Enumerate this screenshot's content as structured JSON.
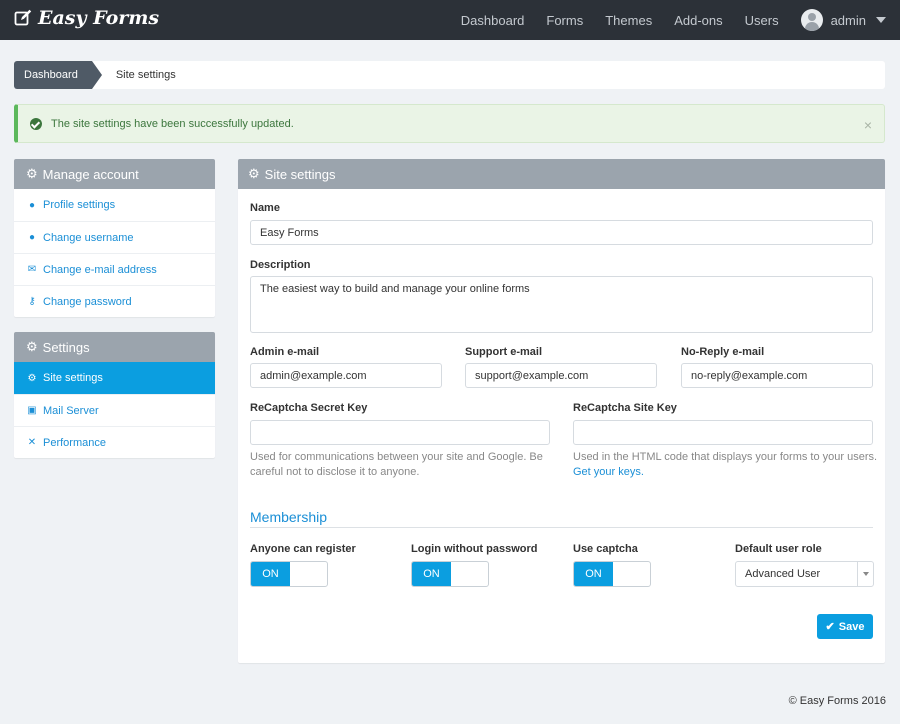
{
  "brand": {
    "name": "Easy Forms"
  },
  "nav": {
    "items": [
      "Dashboard",
      "Forms",
      "Themes",
      "Add-ons",
      "Users"
    ],
    "user": "admin"
  },
  "breadcrumb": {
    "home": "Dashboard",
    "current": "Site settings"
  },
  "alert": {
    "message": "The site settings have been successfully updated.",
    "close": "×"
  },
  "sidebar": {
    "manage_account": {
      "title": "Manage account",
      "items": [
        {
          "label": "Profile settings",
          "icon": "user-icon"
        },
        {
          "label": "Change username",
          "icon": "user-edit-icon"
        },
        {
          "label": "Change e-mail address",
          "icon": "envelope-icon"
        },
        {
          "label": "Change password",
          "icon": "key-icon"
        }
      ]
    },
    "settings": {
      "title": "Settings",
      "items": [
        {
          "label": "Site settings",
          "icon": "gears-icon",
          "active": true
        },
        {
          "label": "Mail Server",
          "icon": "mailbox-icon"
        },
        {
          "label": "Performance",
          "icon": "tools-icon"
        }
      ]
    }
  },
  "main": {
    "title": "Site settings",
    "name": {
      "label": "Name",
      "value": "Easy Forms"
    },
    "description": {
      "label": "Description",
      "value": "The easiest way to build and manage your online forms"
    },
    "admin_email": {
      "label": "Admin e-mail",
      "value": "admin@example.com"
    },
    "support_email": {
      "label": "Support e-mail",
      "value": "support@example.com"
    },
    "noreply_email": {
      "label": "No-Reply e-mail",
      "value": "no-reply@example.com"
    },
    "recaptcha_secret": {
      "label": "ReCaptcha Secret Key",
      "value": "",
      "help": "Used for communications between your site and Google. Be careful not to disclose it to anyone."
    },
    "recaptcha_site": {
      "label": "ReCaptcha Site Key",
      "value": "",
      "help": "Used in the HTML code that displays your forms to your users.",
      "link": "Get your keys."
    },
    "membership": {
      "title": "Membership",
      "anyone_can_register": {
        "label": "Anyone can register",
        "state": "ON"
      },
      "login_without_password": {
        "label": "Login without password",
        "state": "ON"
      },
      "use_captcha": {
        "label": "Use captcha",
        "state": "ON"
      },
      "default_user_role": {
        "label": "Default user role",
        "value": "Advanced User"
      }
    },
    "save_label": "Save"
  },
  "footer": {
    "text": "© Easy Forms 2016"
  },
  "colors": {
    "accent": "#0b9ee0",
    "topbar": "#2c3138",
    "panel_head": "#9ba4ad",
    "success": "#3c763d"
  }
}
